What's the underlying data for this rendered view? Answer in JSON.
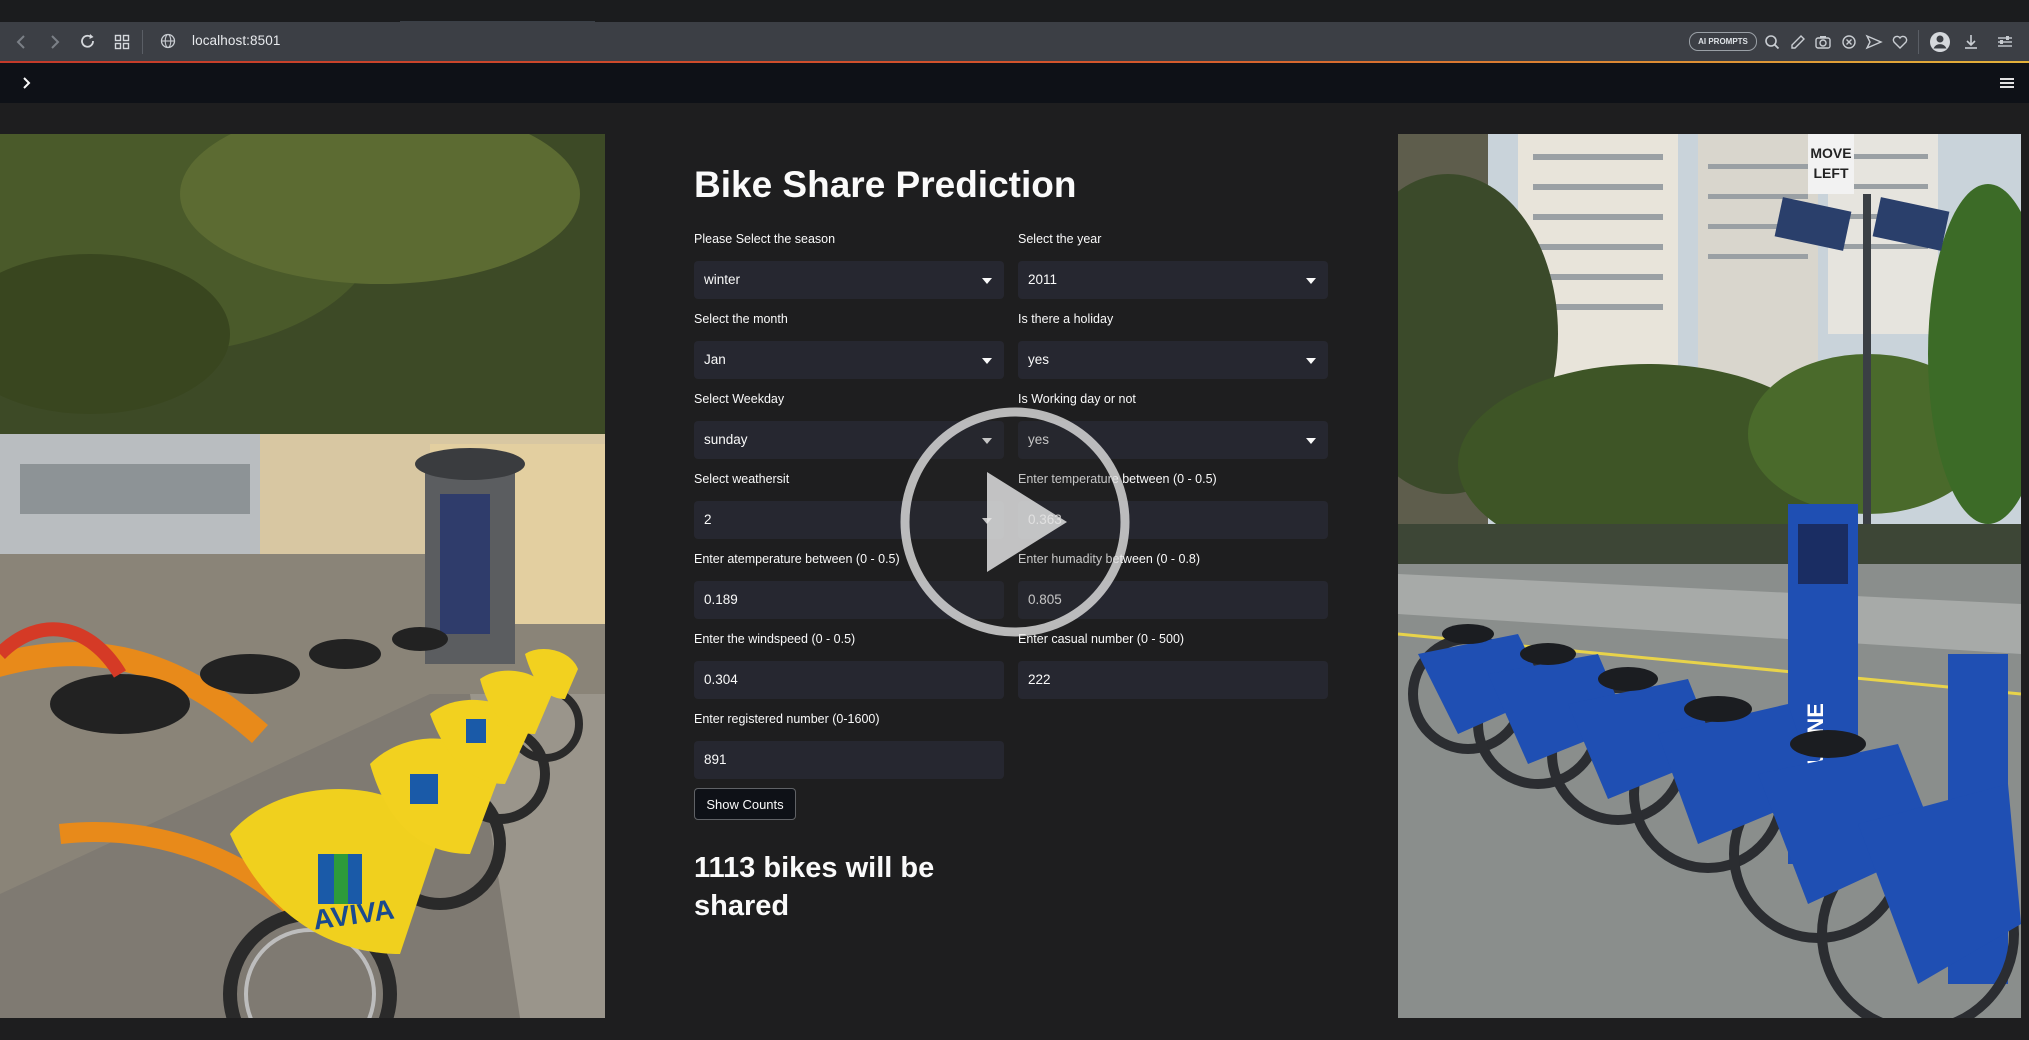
{
  "browser": {
    "url": "localhost:8501",
    "ai_prompts_label": "AI PROMPTS"
  },
  "app": {
    "title": "Bike Share Prediction",
    "fields": {
      "season": {
        "label": "Please Select the season",
        "value": "winter"
      },
      "year": {
        "label": "Select the year",
        "value": "2011"
      },
      "month": {
        "label": "Select the month",
        "value": "Jan"
      },
      "holiday": {
        "label": "Is there a holiday",
        "value": "yes"
      },
      "weekday": {
        "label": "Select Weekday",
        "value": "sunday"
      },
      "workingday": {
        "label": "Is Working day or not",
        "value": "yes"
      },
      "weathersit": {
        "label": "Select weathersit",
        "value": "2"
      },
      "temp": {
        "label": "Enter temperature between (0 - 0.5)",
        "value": "0.363"
      },
      "atemp": {
        "label": "Enter atemperature between (0 - 0.5)",
        "value": "0.189"
      },
      "humidity": {
        "label": "Enter humadity between (0 - 0.8)",
        "value": "0.805"
      },
      "windspeed": {
        "label": "Enter the windspeed (0 - 0.5)",
        "value": "0.304"
      },
      "casual": {
        "label": "Enter casual number (0 - 500)",
        "value": "222"
      },
      "registered": {
        "label": "Enter registered number (0-1600)",
        "value": "891"
      }
    },
    "button_label": "Show Counts",
    "result_text": "1113 bikes will be shared"
  },
  "images": {
    "left_sign": "AVIVA",
    "right_sign_top": "MOVE",
    "right_sign_bottom": "LEFT",
    "right_station": "MELBOURNE"
  },
  "colors": {
    "app_bg": "#0e1117",
    "input_bg": "#262730",
    "browser_bar": "#3c3f45",
    "accent_line": "#c43a2a"
  }
}
